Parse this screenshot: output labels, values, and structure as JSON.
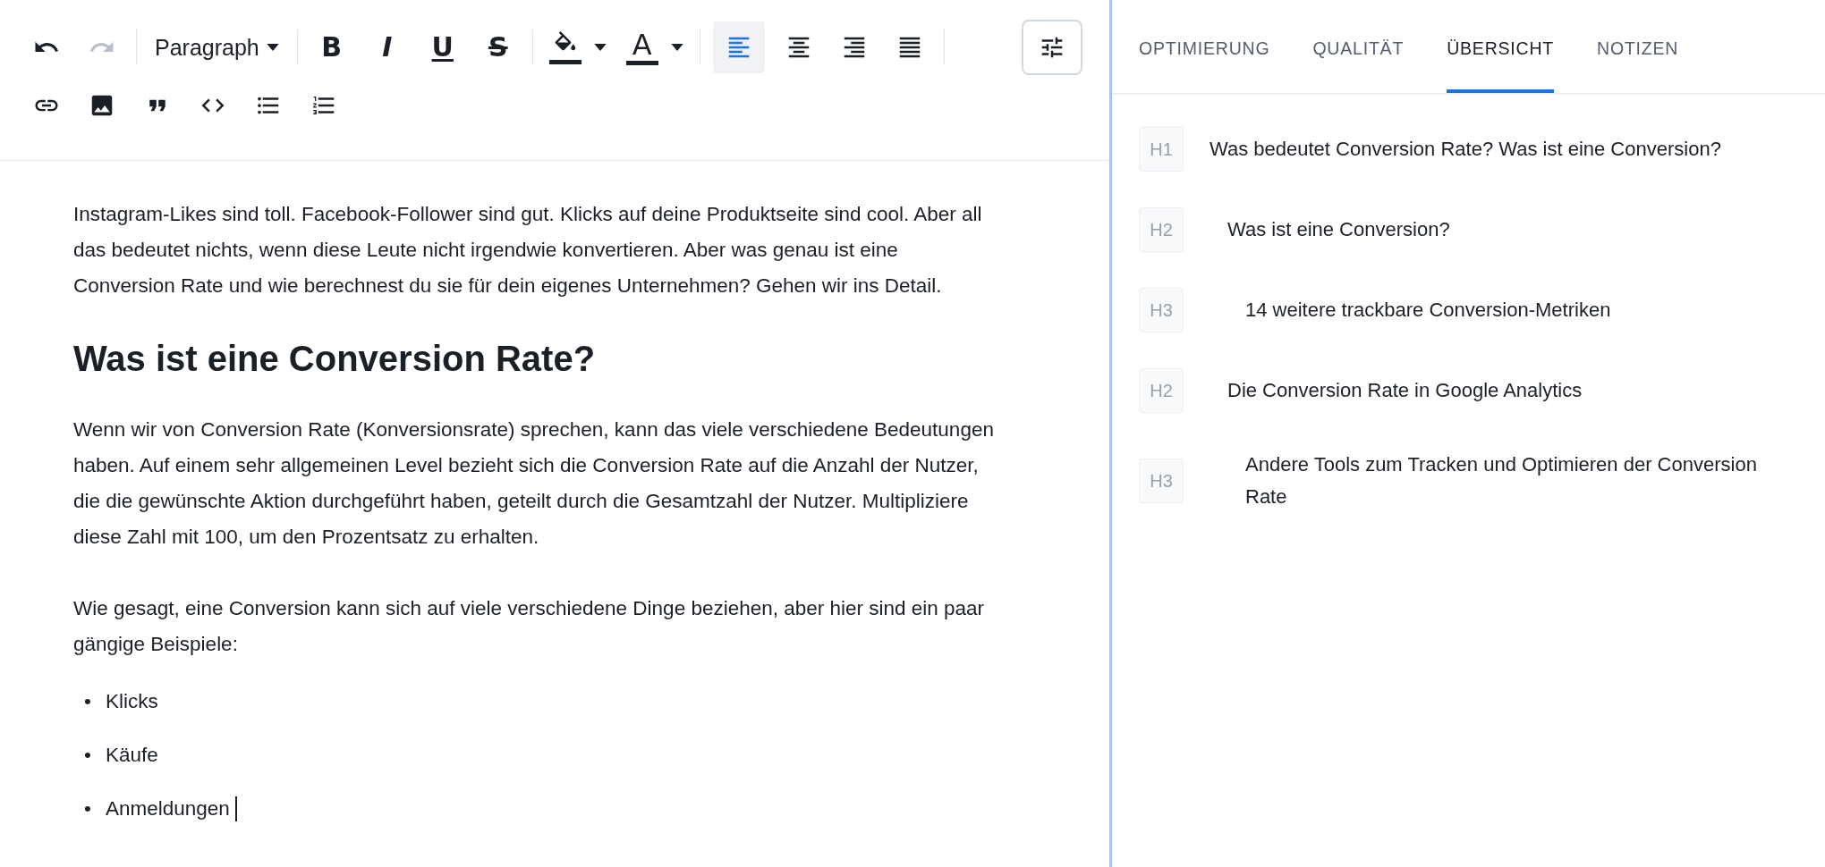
{
  "toolbar": {
    "history": [
      {
        "kind": "undo",
        "disabled": false
      },
      {
        "kind": "redo",
        "disabled": true
      }
    ],
    "block_format": {
      "label": "Paragraph"
    },
    "marks": [
      {
        "kind": "bold",
        "glyph": "B"
      },
      {
        "kind": "italic",
        "glyph": "I"
      },
      {
        "kind": "underline",
        "glyph": "U"
      },
      {
        "kind": "strikethrough",
        "glyph": "S"
      }
    ],
    "colors": [
      {
        "kind": "highlight"
      },
      {
        "kind": "text-color",
        "glyph": "A"
      }
    ],
    "alignment": [
      {
        "kind": "left",
        "selected": true
      },
      {
        "kind": "center",
        "selected": false
      },
      {
        "kind": "right",
        "selected": false
      },
      {
        "kind": "justify",
        "selected": false
      }
    ],
    "inserts": [
      {
        "kind": "link"
      },
      {
        "kind": "image"
      },
      {
        "kind": "quote"
      },
      {
        "kind": "code"
      },
      {
        "kind": "bullet-list"
      },
      {
        "kind": "numbered-list"
      }
    ]
  },
  "document": [
    {
      "kind": "paragraph",
      "text": "Instagram-Likes sind toll. Facebook-Follower sind gut. Klicks auf deine Produktseite sind cool. Aber all das bedeutet nichts, wenn diese Leute nicht irgendwie konvertieren. Aber was genau ist eine Conversion Rate und wie berechnest du sie für dein eigenes Unternehmen? Gehen wir ins Detail."
    },
    {
      "kind": "heading",
      "text": "Was ist eine Conversion Rate?"
    },
    {
      "kind": "paragraph",
      "text": "Wenn wir von Conversion Rate (Konversionsrate) sprechen, kann das viele verschiedene Bedeutungen haben. Auf einem sehr allgemeinen Level bezieht sich die Conversion Rate auf die Anzahl der Nutzer, die die gewünschte Aktion durchgeführt haben, geteilt durch die Gesamtzahl der Nutzer. Multipliziere diese Zahl mit 100, um den Prozentsatz zu erhalten."
    },
    {
      "kind": "paragraph",
      "text": "Wie gesagt, eine Conversion kann sich auf viele verschiedene Dinge beziehen, aber hier sind ein paar gängige Beispiele:"
    },
    {
      "kind": "list",
      "items": [
        {
          "marker": "•",
          "text": "Klicks",
          "caret": false
        },
        {
          "marker": "•",
          "text": "Käufe",
          "caret": false
        },
        {
          "marker": "•",
          "text": "Anmeldungen",
          "caret": true
        }
      ]
    }
  ],
  "sidebar": {
    "tabs": [
      {
        "label": "OPTIMIERUNG",
        "selected": false
      },
      {
        "label": "QUALITÄT",
        "selected": false
      },
      {
        "label": "ÜBERSICHT",
        "selected": true
      },
      {
        "label": "NOTIZEN",
        "selected": false
      }
    ],
    "outline": [
      {
        "badge": "H1",
        "text": "Was bedeutet Conversion Rate? Was ist eine Conversion?",
        "children": [
          {
            "badge": "H2",
            "text": "Was ist eine Conversion?",
            "children": [
              {
                "badge": "H3",
                "text": "14 weitere trackbare Conversion-Metriken"
              }
            ]
          },
          {
            "badge": "H2",
            "text": "Die Conversion Rate in Google Analytics",
            "children": [
              {
                "badge": "H3",
                "text": "Andere Tools zum Tracken und Optimieren der Conversion Rate"
              }
            ]
          }
        ]
      }
    ]
  }
}
